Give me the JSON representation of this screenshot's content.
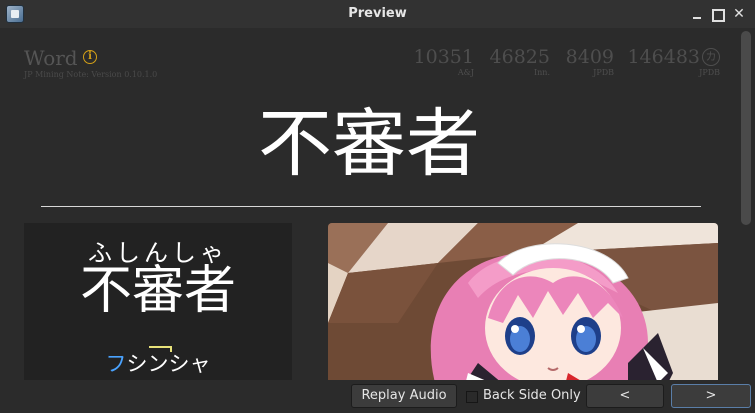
{
  "window": {
    "title": "Preview"
  },
  "card": {
    "word_label": "Word",
    "version": "JP Mining Note: Version 0.10.1.0",
    "frequencies": [
      {
        "value": "10351",
        "source": "A&J"
      },
      {
        "value": "46825",
        "source": "Inn."
      },
      {
        "value": "8409",
        "source": "JPDB"
      },
      {
        "value": "146483",
        "source": "JPDB",
        "badge": "カ"
      }
    ],
    "headword": "不審者",
    "furigana": "ふしんしゃ",
    "reading_word": "不審者",
    "katakana_accent": "フ",
    "katakana_rest": "シンシャ"
  },
  "toolbar": {
    "replay_audio": "Replay Audio",
    "back_side_only": "Back Side Only",
    "prev": "<",
    "next": ">"
  },
  "colors": {
    "accent_pitch": "#4aa3ff",
    "pitch_line": "#e8e27a",
    "info_icon": "#d4a017"
  }
}
